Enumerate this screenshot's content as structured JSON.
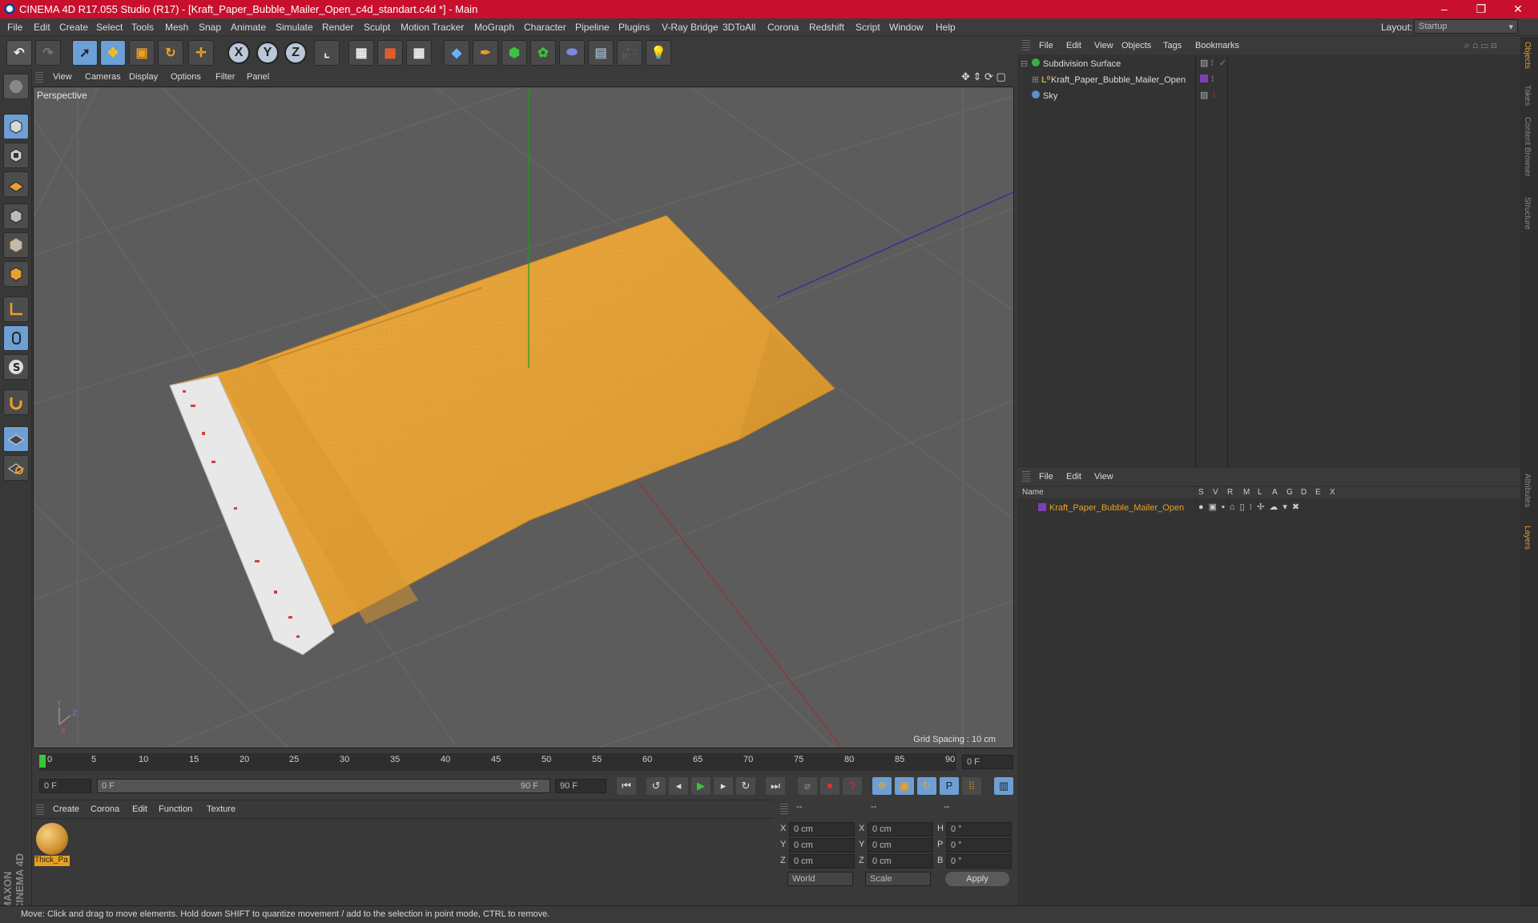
{
  "window": {
    "title": "CINEMA 4D R17.055 Studio (R17) - [Kraft_Paper_Bubble_Mailer_Open_c4d_standart.c4d *] - Main",
    "minimize": "–",
    "maximize": "❐",
    "close": "✕"
  },
  "menu": [
    "File",
    "Edit",
    "Create",
    "Select",
    "Tools",
    "Mesh",
    "Snap",
    "Animate",
    "Simulate",
    "Render",
    "Sculpt",
    "Motion Tracker",
    "MoGraph",
    "Character",
    "Pipeline",
    "Plugins",
    "V-Ray Bridge",
    "3DToAll",
    "Corona",
    "Redshift",
    "Script",
    "Window",
    "Help"
  ],
  "layout": {
    "label": "Layout:",
    "value": "Startup"
  },
  "viewport": {
    "menu": [
      "View",
      "Cameras",
      "Display",
      "Options",
      "Filter",
      "Panel"
    ],
    "label": "Perspective",
    "grid_spacing": "Grid Spacing : 10 cm"
  },
  "timeline": {
    "ticks": [
      "0",
      "5",
      "10",
      "15",
      "20",
      "25",
      "30",
      "35",
      "40",
      "45",
      "50",
      "55",
      "60",
      "65",
      "70",
      "75",
      "80",
      "85",
      "90"
    ],
    "current_frame": "0 F"
  },
  "transport": {
    "start": "0 F",
    "range_start": "0 F",
    "range_end": "90 F",
    "end": "90 F"
  },
  "materials": {
    "menu": [
      "Create",
      "Corona",
      "Edit",
      "Function",
      "Texture"
    ],
    "items": [
      {
        "name": "Thick_Pa"
      }
    ]
  },
  "coords": {
    "headers": [
      "--",
      "--",
      "--"
    ],
    "rows": [
      {
        "a": "X",
        "av": "0 cm",
        "b": "X",
        "bv": "0 cm",
        "c": "H",
        "cv": "0 °"
      },
      {
        "a": "Y",
        "av": "0 cm",
        "b": "Y",
        "bv": "0 cm",
        "c": "P",
        "cv": "0 °"
      },
      {
        "a": "Z",
        "av": "0 cm",
        "b": "Z",
        "bv": "0 cm",
        "c": "B",
        "cv": "0 °"
      }
    ],
    "world": "World",
    "scale": "Scale",
    "apply": "Apply"
  },
  "objects": {
    "menu": [
      "File",
      "Edit",
      "View",
      "Objects",
      "Tags",
      "Bookmarks"
    ],
    "items": [
      {
        "name": "Subdivision Surface",
        "color": "#3cb043"
      },
      {
        "name": "Kraft_Paper_Bubble_Mailer_Open",
        "color": "#c8a84a"
      },
      {
        "name": "Sky",
        "color": "#5a8fd0"
      }
    ]
  },
  "layers": {
    "menu": [
      "File",
      "Edit",
      "View"
    ],
    "columns": [
      "Name",
      "S",
      "V",
      "R",
      "M",
      "L",
      "A",
      "G",
      "D",
      "E",
      "X"
    ],
    "items": [
      {
        "name": "Kraft_Paper_Bubble_Mailer_Open",
        "color": "#e8a020"
      }
    ]
  },
  "side_tabs": [
    "Objects",
    "Takes",
    "Content Browser",
    "Structure",
    "Attributes",
    "Layers"
  ],
  "brand": "MAXON CINEMA 4D",
  "status": "Move: Click and drag to move elements. Hold down SHIFT to quantize movement / add to the selection in point mode, CTRL to remove.",
  "colors": {
    "accent": "#c8102e",
    "selected_tool": "#6e9fd4",
    "mailer": "#e6a640",
    "label_orange": "#e8a020"
  }
}
